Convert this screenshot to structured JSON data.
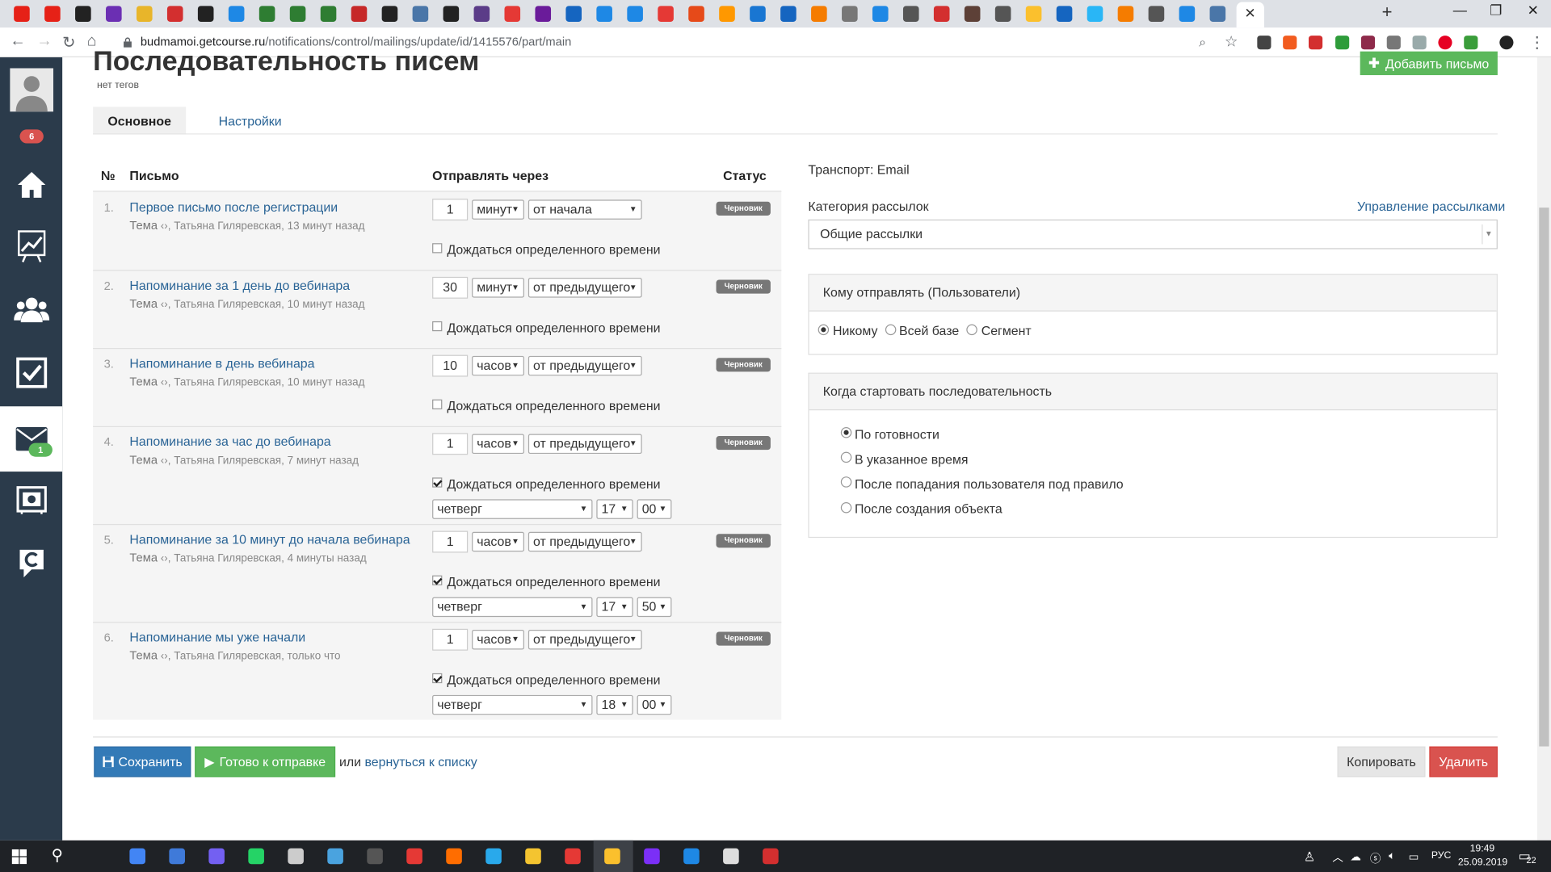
{
  "browser": {
    "url_host": "budmamoi.getcourse.ru",
    "url_path": "/notifications/control/mailings/update/id/1415576/part/main"
  },
  "sidebar": {
    "profile_badge": "6",
    "mail_badge": "1"
  },
  "page": {
    "title": "Последовательность писем",
    "tags": "нет тегов",
    "add_letter_label": "Добавить письмо",
    "tabs": [
      "Основное",
      "Настройки"
    ]
  },
  "table": {
    "headers": {
      "num": "№",
      "letter": "Письмо",
      "send_after": "Отправлять через",
      "status": "Статус"
    },
    "subject_label": "Тема",
    "wait_label": "Дождаться определенного времени",
    "rows": [
      {
        "num": "1.",
        "title": "Первое письмо после регистрации",
        "meta": ", Татьяна Гиляревская, 13 минут назад",
        "amount": "1",
        "unit": "минут",
        "from": "от начала",
        "status": "Черновик",
        "wait": false
      },
      {
        "num": "2.",
        "title": "Напоминание за 1 день до вебинара",
        "meta": ", Татьяна Гиляревская, 10 минут назад",
        "amount": "30",
        "unit": "минут",
        "from": "от предыдущего",
        "status": "Черновик",
        "wait": false
      },
      {
        "num": "3.",
        "title": "Напоминание в день вебинара",
        "meta": ", Татьяна Гиляревская, 10 минут назад",
        "amount": "10",
        "unit": "часов",
        "from": "от предыдущего",
        "status": "Черновик",
        "wait": false
      },
      {
        "num": "4.",
        "title": "Напоминание за час до вебинара",
        "meta": ", Татьяна Гиляревская, 7 минут назад",
        "amount": "1",
        "unit": "часов",
        "from": "от предыдущего",
        "status": "Черновик",
        "wait": true,
        "day": "четверг",
        "hour": "17",
        "minute": "00"
      },
      {
        "num": "5.",
        "title": "Напоминание за 10 минут до начала вебинара",
        "meta": ", Татьяна Гиляревская, 4 минуты назад",
        "amount": "1",
        "unit": "часов",
        "from": "от предыдущего",
        "status": "Черновик",
        "wait": true,
        "day": "четверг",
        "hour": "17",
        "minute": "50"
      },
      {
        "num": "6.",
        "title": "Напоминание мы уже начали",
        "meta": ", Татьяна Гиляревская, только что",
        "amount": "1",
        "unit": "часов",
        "from": "от предыдущего",
        "status": "Черновик",
        "wait": true,
        "day": "четверг",
        "hour": "18",
        "minute": "00"
      }
    ]
  },
  "right": {
    "transport": "Транспорт: Email",
    "category_label": "Категория рассылок",
    "manage_link": "Управление рассылками",
    "category_value": "Общие рассылки",
    "recipients_title": "Кому отправлять (Пользователи)",
    "recipients_options": [
      "Никому",
      "Всей базе",
      "Сегмент"
    ],
    "start_title": "Когда стартовать последовательность",
    "start_options": [
      "По готовности",
      "В указанное время",
      "После попадания пользователя под правило",
      "После создания объекта"
    ]
  },
  "footer": {
    "save_label": "Сохранить",
    "ready_label": "Готово к отправке",
    "or_text": "или",
    "back_link": "вернуться к списку",
    "copy_label": "Копировать",
    "delete_label": "Удалить"
  },
  "taskbar": {
    "lang": "РУС",
    "time": "19:49",
    "date": "25.09.2019",
    "notifications": "22"
  },
  "colors": {
    "link": "#2a6496",
    "primary": "#337ab7",
    "success": "#5cb85c",
    "danger": "#d9534f",
    "sidebar": "#2b3b4b",
    "draft_badge": "#777777"
  }
}
